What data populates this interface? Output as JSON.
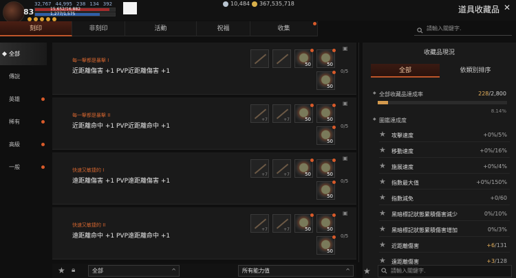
{
  "player": {
    "level": "83",
    "stats": [
      "32,767",
      "44,995",
      "238",
      "134",
      "392"
    ],
    "hp_label": "15,652/16,882",
    "hp_fill": 0.93,
    "mp_label": "1,277/1,575",
    "mp_fill": 0.81
  },
  "currency": {
    "silver": "10,484",
    "gold": "367,535,718"
  },
  "window_title": "道具收藏品",
  "tabs": [
    {
      "label": "刻印",
      "active": true
    },
    {
      "label": "非刻印",
      "active": false
    },
    {
      "label": "活動",
      "active": false
    },
    {
      "label": "祝福",
      "active": false
    },
    {
      "label": "收集",
      "active": false
    }
  ],
  "search": {
    "placeholder": "請輸入關鍵字."
  },
  "categories": [
    {
      "label": "全部",
      "active": true,
      "dot": false
    },
    {
      "label": "傳說",
      "active": false,
      "dot": false
    },
    {
      "label": "英雄",
      "active": false,
      "dot": true
    },
    {
      "label": "稀有",
      "active": false,
      "dot": true
    },
    {
      "label": "高級",
      "active": false,
      "dot": true
    },
    {
      "label": "一般",
      "active": false,
      "dot": true
    }
  ],
  "rows": [
    {
      "title": "每一擊都是暴擊 I",
      "desc": "近距離傷害 +1 PVP近距離傷害 +1",
      "progress": "0/5"
    },
    {
      "title": "每一擊都是暴擊 II",
      "desc": "近距離命中 +1 PVP近距離命中 +1",
      "progress": "0/5"
    },
    {
      "title": "快速又敏捷的 I",
      "desc": "遠距離傷害 +1 PVP遠距離傷害 +1",
      "progress": "0/5"
    },
    {
      "title": "快速又敏捷的 II",
      "desc": "遠距離命中 +1 PVP遠距離命中 +1",
      "progress": "0/5"
    }
  ],
  "slot_qty": "50",
  "slot_plus": "+7",
  "filters": {
    "grade": "全部",
    "ability": "所有能力值"
  },
  "panel": {
    "header": "收藏品現況",
    "tabs": [
      "全部",
      "依類別排序"
    ],
    "overall_label": "全部收藏品達成率",
    "overall_current": "228",
    "overall_total": "/2,800",
    "overall_fraction": 0.0814,
    "overall_pct": "8.14%",
    "section_label": "圖鑑達成度",
    "stats": [
      {
        "name": "攻擊速度",
        "gain": "",
        "value": "+0%/5%"
      },
      {
        "name": "移動速度",
        "gain": "",
        "value": "+0%/16%"
      },
      {
        "name": "施展速度",
        "gain": "",
        "value": "+0%/4%"
      },
      {
        "name": "指數最大值",
        "gain": "",
        "value": "+0%/150%"
      },
      {
        "name": "指數減免",
        "gain": "",
        "value": "+0/60"
      },
      {
        "name": "黑暗標記狀態累積傷害減少",
        "gain": "",
        "value": "0%/10%"
      },
      {
        "name": "黑暗標記狀態累積傷害增加",
        "gain": "",
        "value": "0%/3%"
      },
      {
        "name": "近距離傷害",
        "gain": "+6",
        "value": "/131"
      },
      {
        "name": "遠距離傷害",
        "gain": "+3",
        "value": "/128"
      }
    ]
  }
}
